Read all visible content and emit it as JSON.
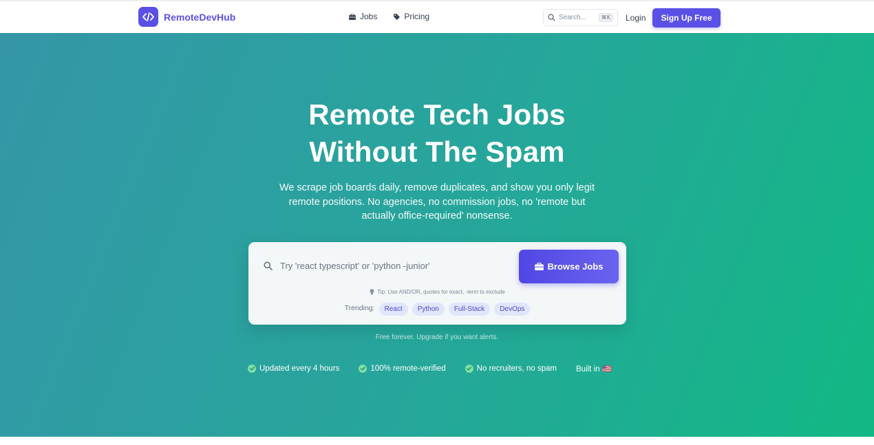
{
  "header": {
    "brand": "RemoteDevHub",
    "nav": [
      {
        "label": "Jobs",
        "icon": "briefcase-icon"
      },
      {
        "label": "Pricing",
        "icon": "tag-icon"
      }
    ],
    "search": {
      "placeholder": "Search...",
      "shortcut": "⌘K"
    },
    "login_label": "Login",
    "signup_label": "Sign Up Free"
  },
  "hero": {
    "title_line1": "Remote Tech Jobs",
    "title_line2": "Without The Spam",
    "subtitle": "We scrape job boards daily, remove duplicates, and show you only legit remote positions. No agencies, no commission jobs, no 'remote but actually office-required' nonsense.",
    "search_placeholder": "Try 'react typescript' or 'python -junior'",
    "browse_label": "Browse Jobs",
    "tip": "Tip: Use AND/OR, quotes for exact, -term to exclude",
    "trending_label": "Trending:",
    "trending": [
      "React",
      "Python",
      "Full-Stack",
      "DevOps"
    ],
    "free_note": "Free forever. Upgrade if you want alerts.",
    "features": [
      "Updated every 4 hours",
      "100% remote-verified",
      "No recruiters, no spam",
      "Built in 🇺🇸"
    ]
  },
  "colors": {
    "brand": "#5b50e6",
    "hero_gradient_start": "#3596a8",
    "hero_gradient_end": "#12b884",
    "check": "#7ee0a7"
  }
}
